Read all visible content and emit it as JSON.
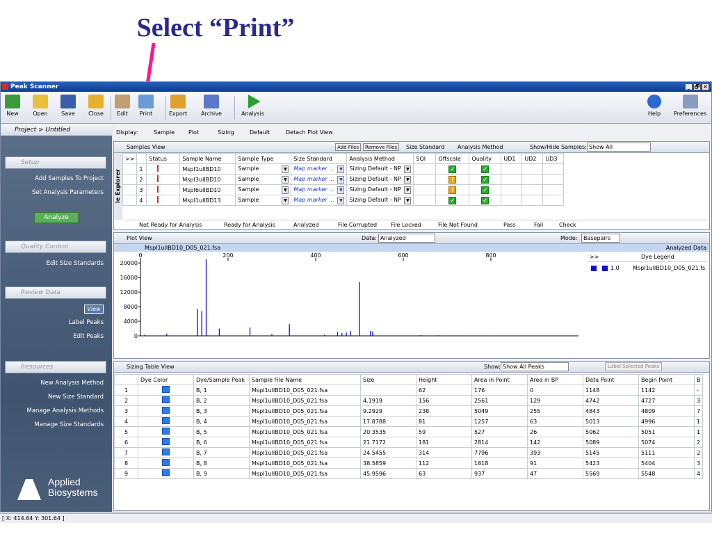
{
  "slide": {
    "title": "Select “Print”"
  },
  "window": {
    "title": "Peak Scanner",
    "min": "_",
    "restore": "🗗",
    "close": "×"
  },
  "toolbar": {
    "new": "New",
    "open": "Open",
    "save": "Save",
    "close": "Close",
    "edit": "Edit",
    "print": "Print",
    "export": "Export",
    "archive": "Archive",
    "analysis": "Analysis",
    "help": "Help",
    "preferences": "Preferences"
  },
  "sidebar": {
    "breadcrumb": "Project > Untitled",
    "setup": "Setup",
    "add_samples": "Add Samples To Project",
    "set_params": "Set Analysis Parameters",
    "analyze": "Analyze",
    "qc": "Quality Control",
    "edit_size": "Edit Size Standards",
    "review": "Review Data",
    "view": "View",
    "label_peaks": "Label Peaks",
    "edit_peaks": "Edit Peaks",
    "resources": "Resources",
    "new_analysis": "New Analysis Method",
    "new_size": "New Size Standard",
    "manage_analysis": "Manage Analysis Methods",
    "manage_size": "Manage Size Standards",
    "logo1": "Applied",
    "logo2": "Biosystems"
  },
  "display": {
    "label": "Display:",
    "sample": "Sample",
    "plot": "Plot",
    "sizing": "Sizing",
    "default": "Default",
    "detach": "Detach Plot View"
  },
  "samples": {
    "title": "Samples View",
    "add": "Add Files",
    "remove": "Remove Files",
    "size_std": "Size Standard",
    "analysis_method": "Analysis Method",
    "show_hide": "Show/Hide Samples:",
    "show_all": "Show All",
    "explorer": "le Explorer",
    "headers": [
      ">>",
      "",
      "Status",
      "Sample Name",
      "Sample Type",
      "Size Standard",
      "Analysis Method",
      "SQI",
      "Offscale",
      "Quality",
      "UD1",
      "UD2",
      "UD3"
    ],
    "rows": [
      {
        "n": "1",
        "name": "MspI1ulIBD10",
        "type": "Sample",
        "std": "Map marker ...",
        "method": "Sizing Default - NP",
        "off": "ok"
      },
      {
        "n": "2",
        "name": "MspI3ulIBD10",
        "type": "Sample",
        "std": "Map marker ...",
        "method": "Sizing Default - NP",
        "off": "warn"
      },
      {
        "n": "3",
        "name": "MspI6ulIBD10",
        "type": "Sample",
        "std": "Map marker ...",
        "method": "Sizing Default - NP",
        "off": "warn"
      },
      {
        "n": "4",
        "name": "MspI1ulIBD13",
        "type": "Sample",
        "std": "Map marker ...",
        "method": "Sizing Default - NP",
        "off": "ok"
      }
    ],
    "legend": {
      "not_ready": "Not Ready for Analysis",
      "ready": "Ready for Analysis",
      "analyzed": "Analyzed",
      "corrupted": "File Corrupted",
      "locked": "File Locked",
      "not_found": "File Not Found",
      "pass": "Pass",
      "fail": "Fail",
      "check": "Check"
    }
  },
  "plot": {
    "title": "Plot View",
    "data_label": "Data:",
    "data_value": "Analyzed",
    "mode_label": "Mode:",
    "mode_value": "Basepairs",
    "file": "MspI1ulIBD10_D05_021.fsa",
    "analyzed_data": "Analyzed Data",
    "dye_legend": "Dye Legend",
    "legend_val": "1.0",
    "legend_file": "MspI1ulIBD10_D05_021.fs",
    "arrow": ">>"
  },
  "chart_data": {
    "type": "line",
    "x_ticks": [
      0,
      200,
      400,
      600,
      800
    ],
    "y_ticks": [
      0,
      4000,
      8000,
      12000,
      16000,
      20000
    ],
    "xlim": [
      0,
      1000
    ],
    "ylim": [
      0,
      21000
    ],
    "peaks": [
      [
        10,
        300
      ],
      [
        60,
        600
      ],
      [
        130,
        7400
      ],
      [
        140,
        6800
      ],
      [
        150,
        21000
      ],
      [
        180,
        2000
      ],
      [
        250,
        2300
      ],
      [
        300,
        500
      ],
      [
        340,
        3200
      ],
      [
        420,
        300
      ],
      [
        450,
        1100
      ],
      [
        460,
        800
      ],
      [
        470,
        900
      ],
      [
        480,
        1300
      ],
      [
        500,
        14800
      ],
      [
        525,
        1300
      ],
      [
        530,
        1200
      ],
      [
        640,
        200
      ],
      [
        680,
        150
      ],
      [
        730,
        120
      ],
      [
        800,
        100
      ]
    ],
    "color": "#1010c8"
  },
  "sizing": {
    "title": "Sizing Table View",
    "show_label": "Show:",
    "show_value": "Show All Peaks",
    "label_selected": "Label Selected Peaks",
    "headers": [
      "",
      "Dye Color",
      "Dye/Sample Peak",
      "Sample File Name",
      "Size",
      "Height",
      "Area in Point",
      "Area in BP",
      "Data Point",
      "Begin Point",
      "B"
    ],
    "rows": [
      [
        "1",
        "",
        "B, 1",
        "MspI1ulIBD10_D05_021.fsa",
        "",
        "62",
        "176",
        "0",
        "1148",
        "1142",
        "-"
      ],
      [
        "2",
        "",
        "B, 2",
        "MspI1ulIBD10_D05_021.fsa",
        "4.1919",
        "156",
        "2561",
        "129",
        "4742",
        "4727",
        "3"
      ],
      [
        "3",
        "",
        "B, 3",
        "MspI1ulIBD10_D05_021.fsa",
        "9.2929",
        "238",
        "5049",
        "255",
        "4843",
        "4809",
        "7"
      ],
      [
        "4",
        "",
        "B, 4",
        "MspI1ulIBD10_D05_021.fsa",
        "17.8788",
        "81",
        "1257",
        "63",
        "5013",
        "4996",
        "1"
      ],
      [
        "5",
        "",
        "B, 5",
        "MspI1ulIBD10_D05_021.fsa",
        "20.3535",
        "59",
        "527",
        "26",
        "5062",
        "5051",
        "1"
      ],
      [
        "6",
        "",
        "B, 6",
        "MspI1ulIBD10_D05_021.fsa",
        "21.7172",
        "181",
        "2814",
        "142",
        "5089",
        "5074",
        "2"
      ],
      [
        "7",
        "",
        "B, 7",
        "MspI1ulIBD10_D05_021.fsa",
        "24.5455",
        "314",
        "7796",
        "393",
        "5145",
        "5111",
        "2"
      ],
      [
        "8",
        "",
        "B, 8",
        "MspI1ulIBD10_D05_021.fsa",
        "38.5859",
        "112",
        "1818",
        "91",
        "5423",
        "5404",
        "3"
      ],
      [
        "9",
        "",
        "B, 9",
        "MspI1ulIBD10_D05_021.fsa",
        "45.9596",
        "63",
        "937",
        "47",
        "5569",
        "5548",
        "4"
      ]
    ]
  },
  "status": {
    "coords": "[ X: 414.64  Y: 301.64 ]"
  },
  "colors": {
    "arrow": "#ff1493",
    "title": "#2a2a8a"
  }
}
